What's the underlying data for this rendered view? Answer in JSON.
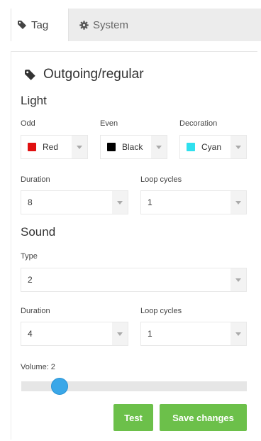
{
  "tabs": [
    {
      "label": "Tag",
      "icon": "tag-icon"
    },
    {
      "label": "System",
      "icon": "gear-icon"
    }
  ],
  "heading": {
    "title": "Outgoing/regular",
    "icon": "tag-icon"
  },
  "light": {
    "title": "Light",
    "odd": {
      "label": "Odd",
      "value": "Red",
      "color": "#e01010"
    },
    "even": {
      "label": "Even",
      "value": "Black",
      "color": "#000000"
    },
    "decoration": {
      "label": "Decoration",
      "value": "Cyan",
      "color": "#2fe0ee"
    },
    "duration": {
      "label": "Duration",
      "value": "8"
    },
    "loop": {
      "label": "Loop cycles",
      "value": "1"
    }
  },
  "sound": {
    "title": "Sound",
    "type": {
      "label": "Type",
      "value": "2"
    },
    "duration": {
      "label": "Duration",
      "value": "4"
    },
    "loop": {
      "label": "Loop cycles",
      "value": "1"
    }
  },
  "volume": {
    "label": "Volume: 2",
    "value": 2,
    "fraction": 0.17
  },
  "buttons": {
    "test": "Test",
    "save": "Save changes"
  },
  "colors": {
    "accent": "#6cc04a",
    "slider": "#3aa7e8"
  }
}
